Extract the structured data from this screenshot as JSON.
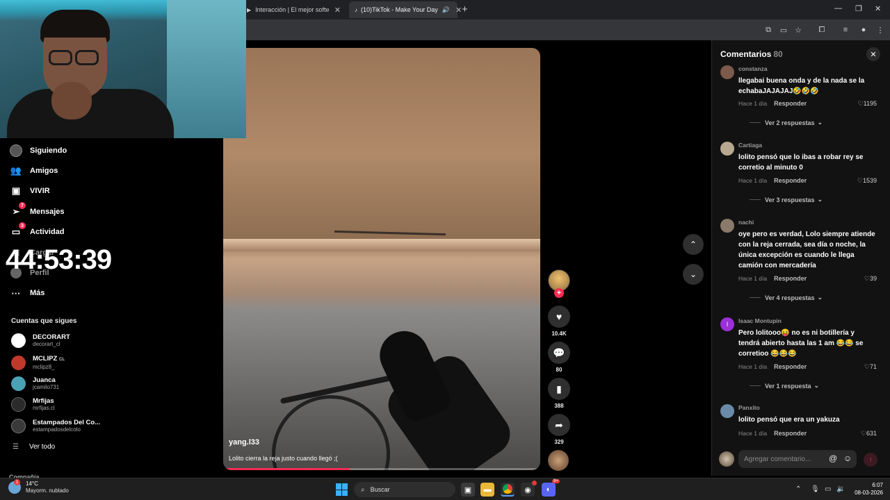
{
  "browser": {
    "tabs": [
      {
        "label": "Interacción | El mejor software",
        "active": false
      },
      {
        "label": "(10)TikTok - Make Your Day",
        "active": true
      }
    ],
    "new_tab_icon": "plus-icon"
  },
  "sidebar": {
    "nav": [
      {
        "label": "Siguiendo",
        "icon": "following-avatar-icon",
        "badge": ""
      },
      {
        "label": "Amigos",
        "icon": "friends-icon",
        "badge": ""
      },
      {
        "label": "VIVIR",
        "icon": "live-icon",
        "badge": ""
      },
      {
        "label": "Mensajes",
        "icon": "messages-icon",
        "badge": "7"
      },
      {
        "label": "Actividad",
        "icon": "activity-icon",
        "badge": "3"
      },
      {
        "label": "Cargar",
        "icon": "upload-icon",
        "badge": ""
      },
      {
        "label": "Perfil",
        "icon": "profile-icon",
        "badge": ""
      },
      {
        "label": "Más",
        "icon": "more-icon",
        "badge": ""
      }
    ],
    "timer_overlay": "44:53:39",
    "following_title": "Cuentas que sigues",
    "accounts": [
      {
        "name": "DECORART",
        "handle": "decorart_cl",
        "color": "#ffffff"
      },
      {
        "name": "MCLIPZ",
        "tag": "CL",
        "handle": "mclipz8_",
        "color": "#c0392b"
      },
      {
        "name": "Juanca",
        "handle": "jcamilo731",
        "color": "#4aa3b5"
      },
      {
        "name": "Mrfijas",
        "handle": "mrfijas.cl",
        "color": "#2a2a2a"
      },
      {
        "name": "Estampados Del Co...",
        "handle": "estampadosdelcolo",
        "color": "#3a3a3a"
      }
    ],
    "see_all": "Ver todo",
    "company": "Compañía"
  },
  "video": {
    "username": "yang.l33",
    "description": "Lolito cierra la reja justo cuando llegó ;(",
    "progress": 0.4
  },
  "actions": {
    "likes": "10.4K",
    "comments": "80",
    "saves": "388",
    "shares": "329"
  },
  "comments_panel": {
    "title": "Comentarios",
    "count": "80",
    "comments": [
      {
        "user": "constanza",
        "text": "llegabai buena onda y de la nada se la echabaJAJAJAJ🤣🤣🤣",
        "time": "Hace 1 día",
        "reply": "Responder",
        "likes": "1195",
        "replies": "Ver 2 respuestas",
        "avatar_color": "#7a5a4a"
      },
      {
        "user": "Cartiaga",
        "text": "lolito pensó que lo ibas a robar rey se corretio al minuto 0",
        "time": "Hace 1 día",
        "reply": "Responder",
        "likes": "1539",
        "replies": "Ver 3 respuestas",
        "avatar_color": "#b8a890"
      },
      {
        "user": "nachi",
        "text": "oye pero es verdad, Lolo siempre atiende con la reja cerrada, sea día o noche, la única excepción es cuando le llega camión con mercadería",
        "time": "Hace 1 día",
        "reply": "Responder",
        "likes": "39",
        "replies": "Ver 4 respuestas",
        "avatar_color": "#8a7a6a"
      },
      {
        "user": "Isaac Montupin",
        "initial": "I",
        "text": "Pero lolitooo😝 no es ni botillería y tendrá abierto hasta las 1 am 😂😂 se corretioo 😂😂😂",
        "time": "Hace 1 día",
        "reply": "Responder",
        "likes": "71",
        "replies": "Ver 1 respuesta",
        "avatar_color": "#9b30d9"
      },
      {
        "user": "Panxito",
        "text": "lolito pensó que era un yakuza",
        "time": "Hace 1 día",
        "reply": "Responder",
        "likes": "631",
        "replies": "",
        "avatar_color": "#6a8aa8"
      }
    ],
    "input_placeholder": "Agregar comentario..."
  },
  "taskbar": {
    "weather_temp": "14°C",
    "weather_desc": "Mayorm. nublado",
    "weather_badge": "1",
    "search_placeholder": "Buscar",
    "time": "6:07",
    "date": "08-03-2026",
    "discord_badge": "9+"
  }
}
